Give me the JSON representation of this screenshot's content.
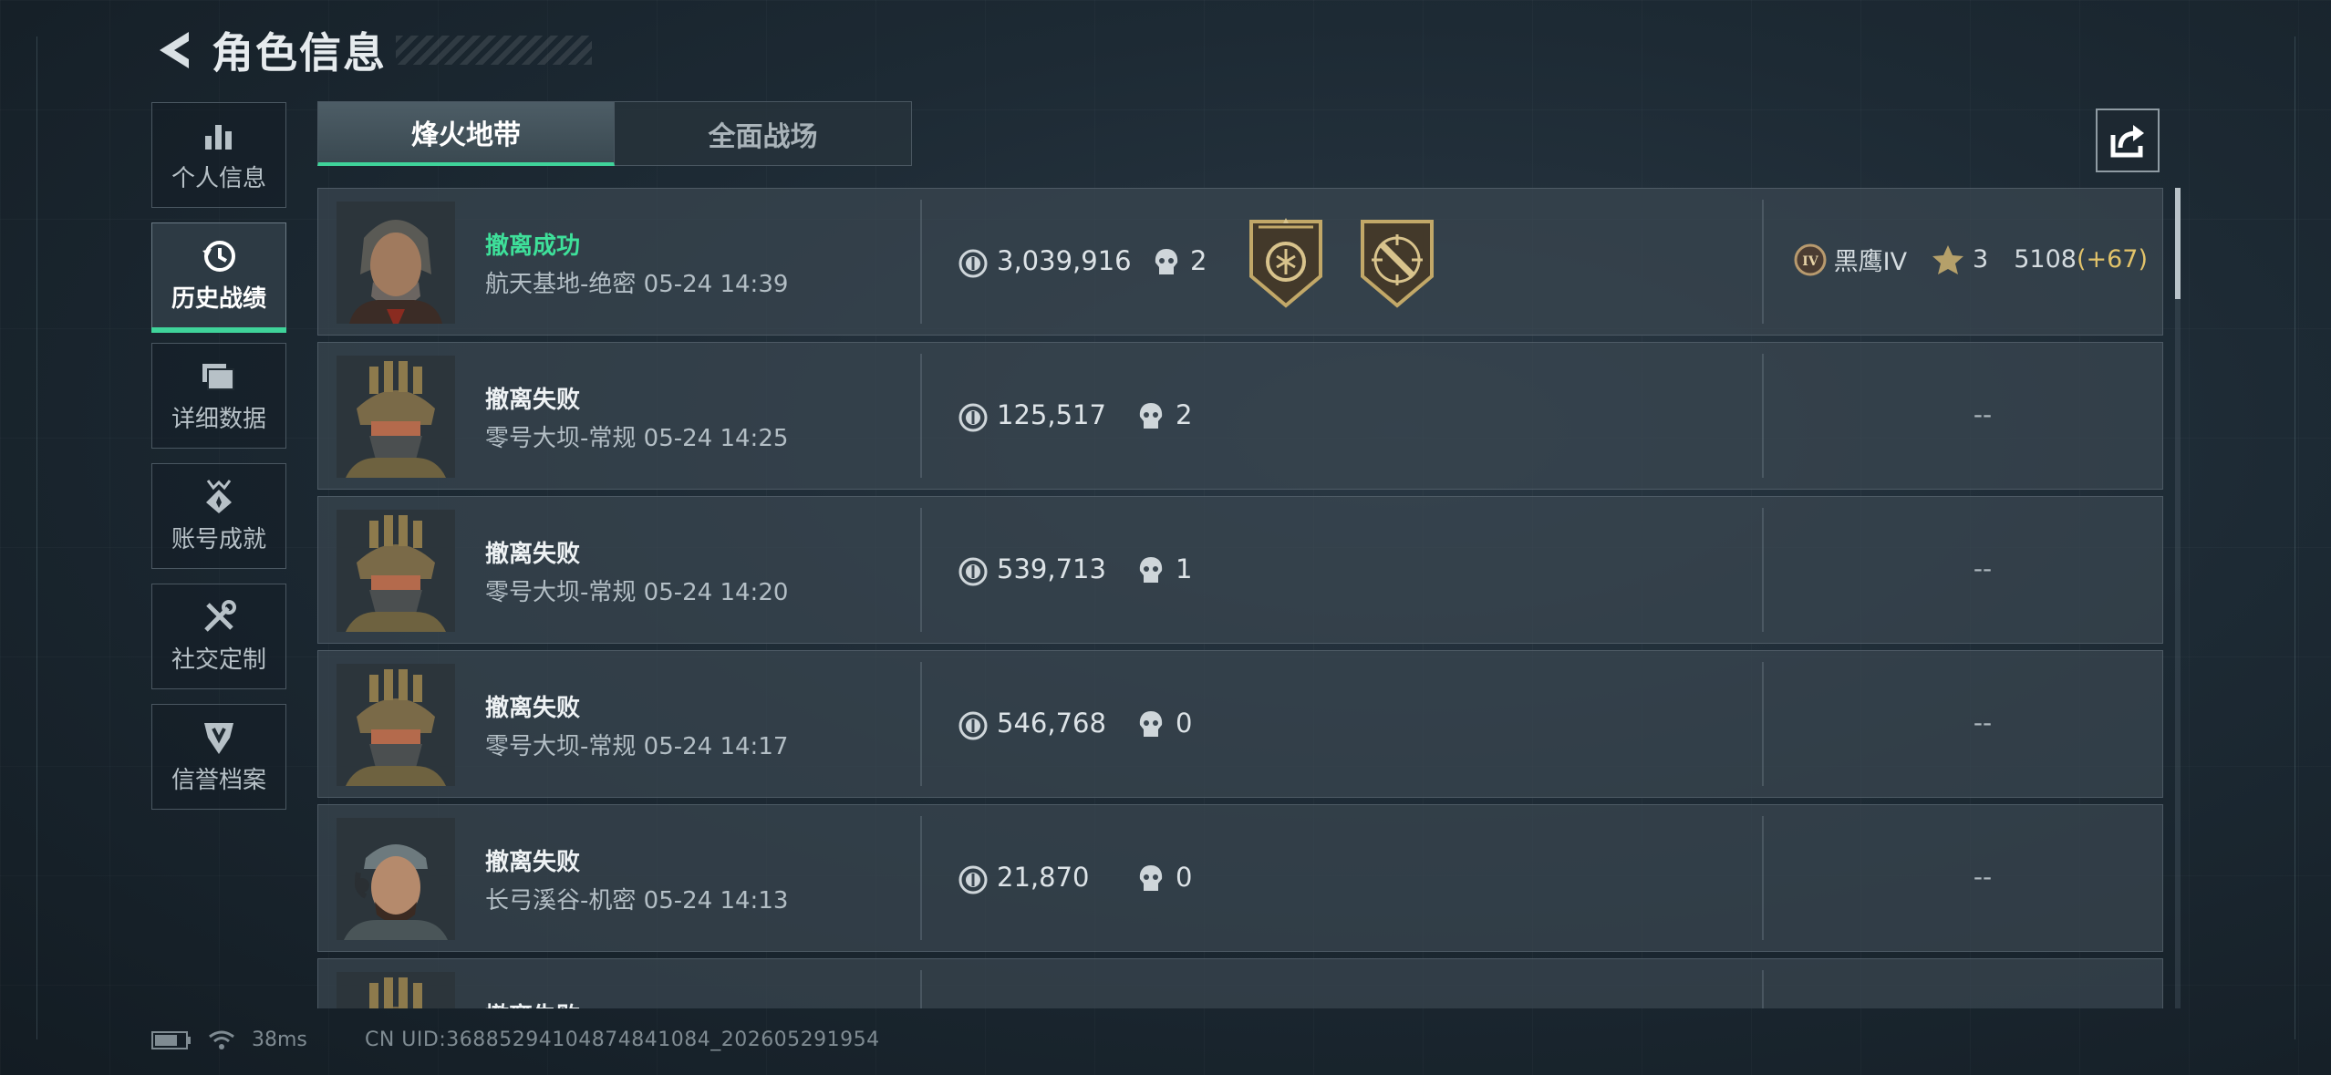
{
  "header": {
    "title": "角色信息"
  },
  "nav": [
    {
      "label": "个人信息",
      "icon": "bar-chart-icon",
      "active": false
    },
    {
      "label": "历史战绩",
      "icon": "clock-history-icon",
      "active": true
    },
    {
      "label": "详细数据",
      "icon": "folder-stack-icon",
      "active": false
    },
    {
      "label": "账号成就",
      "icon": "achievement-badge-icon",
      "active": false
    },
    {
      "label": "社交定制",
      "icon": "tools-icon",
      "active": false
    },
    {
      "label": "信誉档案",
      "icon": "credit-shield-icon",
      "active": false
    }
  ],
  "tabs": [
    {
      "label": "烽火地带",
      "active": true
    },
    {
      "label": "全面战场",
      "active": false
    }
  ],
  "colors": {
    "accent": "#3fd39a",
    "delta": "#e2c36a"
  },
  "matches": [
    {
      "status": "撤离成功",
      "success": true,
      "map": "航天基地-绝密",
      "time": "05-24 14:39",
      "value": "3,039,916",
      "kills": "2",
      "medals": [
        "medal-coin-icon",
        "medal-dagger-icon"
      ],
      "rank": {
        "badge": "IV",
        "name": "黑鹰IV",
        "stars": "3",
        "score": "5108",
        "delta": "(+67)"
      }
    },
    {
      "status": "撤离失败",
      "success": false,
      "map": "零号大坝-常规",
      "time": "05-24 14:25",
      "value": "125,517",
      "kills": "2",
      "medals": [],
      "rank_text": "--"
    },
    {
      "status": "撤离失败",
      "success": false,
      "map": "零号大坝-常规",
      "time": "05-24 14:20",
      "value": "539,713",
      "kills": "1",
      "medals": [],
      "rank_text": "--"
    },
    {
      "status": "撤离失败",
      "success": false,
      "map": "零号大坝-常规",
      "time": "05-24 14:17",
      "value": "546,768",
      "kills": "0",
      "medals": [],
      "rank_text": "--"
    },
    {
      "status": "撤离失败",
      "success": false,
      "map": "长弓溪谷-机密",
      "time": "05-24 14:13",
      "value": "21,870",
      "kills": "0",
      "medals": [],
      "rank_text": "--"
    },
    {
      "status": "撤离失败",
      "success": false,
      "map": "",
      "time": "",
      "value": "",
      "kills": "",
      "medals": [],
      "rank_text": ""
    }
  ],
  "footer": {
    "ping": "38ms",
    "uid": "CN UID:36885294104874841084_202605291954"
  }
}
